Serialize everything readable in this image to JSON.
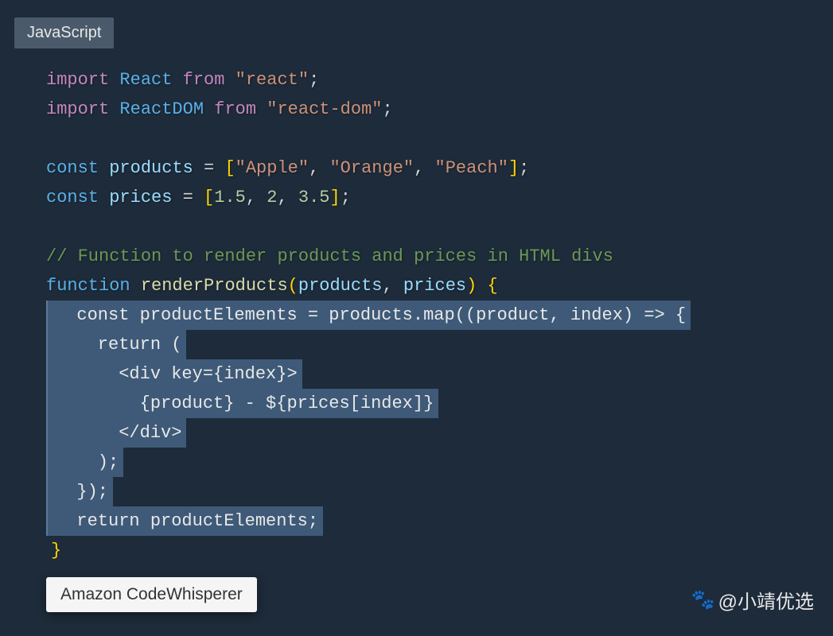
{
  "language_tab": "JavaScript",
  "code": {
    "line1_import": "import",
    "line1_react": "React",
    "line1_from": "from",
    "line1_str": "\"react\"",
    "line1_semi": ";",
    "line2_import": "import",
    "line2_reactdom": "ReactDOM",
    "line2_from": "from",
    "line2_str": "\"react-dom\"",
    "line2_semi": ";",
    "line4_const": "const",
    "line4_var": "products",
    "line4_eq": " = ",
    "line4_lb": "[",
    "line4_s1": "\"Apple\"",
    "line4_c1": ", ",
    "line4_s2": "\"Orange\"",
    "line4_c2": ", ",
    "line4_s3": "\"Peach\"",
    "line4_rb": "]",
    "line4_semi": ";",
    "line5_const": "const",
    "line5_var": "prices",
    "line5_eq": " = ",
    "line5_lb": "[",
    "line5_n1": "1.5",
    "line5_c1": ", ",
    "line5_n2": "2",
    "line5_c2": ", ",
    "line5_n3": "3.5",
    "line5_rb": "]",
    "line5_semi": ";",
    "line7_comment": "// Function to render products and prices in HTML divs",
    "line8_func": "function",
    "line8_name": "renderProducts",
    "line8_lp": "(",
    "line8_p1": "products",
    "line8_c": ", ",
    "line8_p2": "prices",
    "line8_rp": ")",
    "line8_sp": " ",
    "line8_lb": "{"
  },
  "suggestion": {
    "l1": "  const productElements = products.map((product, index) => {",
    "l2": "    return (",
    "l3": "      <div key={index}>",
    "l4": "        {product} - ${prices[index]}",
    "l5": "      </div>",
    "l6": "    );",
    "l7": "  });",
    "l8": "  return productElements;"
  },
  "close_brace": "}",
  "tooltip": "Amazon CodeWhisperer",
  "watermark": "@小靖优选"
}
